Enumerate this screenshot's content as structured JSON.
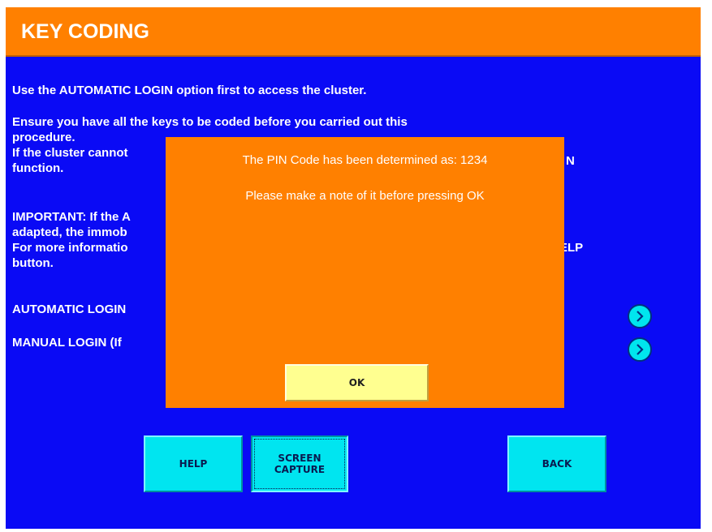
{
  "header": {
    "title": "KEY CODING"
  },
  "body_text": {
    "p1": "Use the AUTOMATIC LOGIN option first to access the cluster.",
    "p2_line1": "Ensure you have all the keys to be coded before you carried out this",
    "p2_line2": "procedure.",
    "p2_line3": "If the cluster cannot",
    "p2_line3_tail": "N",
    "p2_line4": "function.",
    "p3_line1": "IMPORTANT: If the A",
    "p3_line2": "adapted, the immob",
    "p3_line3": "For more informatio",
    "p3_line3_tail": "ELP",
    "p3_line4": "button."
  },
  "options": {
    "automatic_login": "AUTOMATIC LOGIN",
    "manual_login": "MANUAL LOGIN   (If"
  },
  "icons": {
    "arrow": "chevron-right-icon"
  },
  "dialog": {
    "message_line1": "The PIN Code has been determined as: 1234",
    "message_line2": "Please make a note of it before pressing OK",
    "ok_label": "OK"
  },
  "buttons": {
    "help": "HELP",
    "screen_capture_line1": "SCREEN",
    "screen_capture_line2": "CAPTURE",
    "back": "BACK"
  },
  "colors": {
    "background": "#0a0af5",
    "header": "#ff8000",
    "dialog": "#ff8000",
    "button": "#00e5f0",
    "ok_button": "#ffff90"
  }
}
